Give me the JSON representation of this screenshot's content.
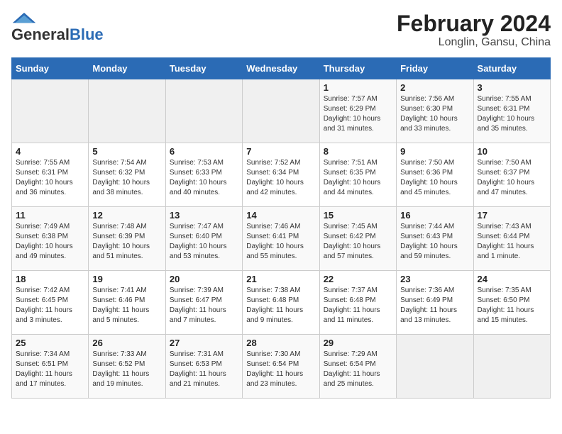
{
  "header": {
    "logo_general": "General",
    "logo_blue": "Blue",
    "title": "February 2024",
    "subtitle": "Longlin, Gansu, China"
  },
  "weekdays": [
    "Sunday",
    "Monday",
    "Tuesday",
    "Wednesday",
    "Thursday",
    "Friday",
    "Saturday"
  ],
  "weeks": [
    [
      {
        "day": "",
        "info": ""
      },
      {
        "day": "",
        "info": ""
      },
      {
        "day": "",
        "info": ""
      },
      {
        "day": "",
        "info": ""
      },
      {
        "day": "1",
        "info": "Sunrise: 7:57 AM\nSunset: 6:29 PM\nDaylight: 10 hours\nand 31 minutes."
      },
      {
        "day": "2",
        "info": "Sunrise: 7:56 AM\nSunset: 6:30 PM\nDaylight: 10 hours\nand 33 minutes."
      },
      {
        "day": "3",
        "info": "Sunrise: 7:55 AM\nSunset: 6:31 PM\nDaylight: 10 hours\nand 35 minutes."
      }
    ],
    [
      {
        "day": "4",
        "info": "Sunrise: 7:55 AM\nSunset: 6:31 PM\nDaylight: 10 hours\nand 36 minutes."
      },
      {
        "day": "5",
        "info": "Sunrise: 7:54 AM\nSunset: 6:32 PM\nDaylight: 10 hours\nand 38 minutes."
      },
      {
        "day": "6",
        "info": "Sunrise: 7:53 AM\nSunset: 6:33 PM\nDaylight: 10 hours\nand 40 minutes."
      },
      {
        "day": "7",
        "info": "Sunrise: 7:52 AM\nSunset: 6:34 PM\nDaylight: 10 hours\nand 42 minutes."
      },
      {
        "day": "8",
        "info": "Sunrise: 7:51 AM\nSunset: 6:35 PM\nDaylight: 10 hours\nand 44 minutes."
      },
      {
        "day": "9",
        "info": "Sunrise: 7:50 AM\nSunset: 6:36 PM\nDaylight: 10 hours\nand 45 minutes."
      },
      {
        "day": "10",
        "info": "Sunrise: 7:50 AM\nSunset: 6:37 PM\nDaylight: 10 hours\nand 47 minutes."
      }
    ],
    [
      {
        "day": "11",
        "info": "Sunrise: 7:49 AM\nSunset: 6:38 PM\nDaylight: 10 hours\nand 49 minutes."
      },
      {
        "day": "12",
        "info": "Sunrise: 7:48 AM\nSunset: 6:39 PM\nDaylight: 10 hours\nand 51 minutes."
      },
      {
        "day": "13",
        "info": "Sunrise: 7:47 AM\nSunset: 6:40 PM\nDaylight: 10 hours\nand 53 minutes."
      },
      {
        "day": "14",
        "info": "Sunrise: 7:46 AM\nSunset: 6:41 PM\nDaylight: 10 hours\nand 55 minutes."
      },
      {
        "day": "15",
        "info": "Sunrise: 7:45 AM\nSunset: 6:42 PM\nDaylight: 10 hours\nand 57 minutes."
      },
      {
        "day": "16",
        "info": "Sunrise: 7:44 AM\nSunset: 6:43 PM\nDaylight: 10 hours\nand 59 minutes."
      },
      {
        "day": "17",
        "info": "Sunrise: 7:43 AM\nSunset: 6:44 PM\nDaylight: 11 hours\nand 1 minute."
      }
    ],
    [
      {
        "day": "18",
        "info": "Sunrise: 7:42 AM\nSunset: 6:45 PM\nDaylight: 11 hours\nand 3 minutes."
      },
      {
        "day": "19",
        "info": "Sunrise: 7:41 AM\nSunset: 6:46 PM\nDaylight: 11 hours\nand 5 minutes."
      },
      {
        "day": "20",
        "info": "Sunrise: 7:39 AM\nSunset: 6:47 PM\nDaylight: 11 hours\nand 7 minutes."
      },
      {
        "day": "21",
        "info": "Sunrise: 7:38 AM\nSunset: 6:48 PM\nDaylight: 11 hours\nand 9 minutes."
      },
      {
        "day": "22",
        "info": "Sunrise: 7:37 AM\nSunset: 6:48 PM\nDaylight: 11 hours\nand 11 minutes."
      },
      {
        "day": "23",
        "info": "Sunrise: 7:36 AM\nSunset: 6:49 PM\nDaylight: 11 hours\nand 13 minutes."
      },
      {
        "day": "24",
        "info": "Sunrise: 7:35 AM\nSunset: 6:50 PM\nDaylight: 11 hours\nand 15 minutes."
      }
    ],
    [
      {
        "day": "25",
        "info": "Sunrise: 7:34 AM\nSunset: 6:51 PM\nDaylight: 11 hours\nand 17 minutes."
      },
      {
        "day": "26",
        "info": "Sunrise: 7:33 AM\nSunset: 6:52 PM\nDaylight: 11 hours\nand 19 minutes."
      },
      {
        "day": "27",
        "info": "Sunrise: 7:31 AM\nSunset: 6:53 PM\nDaylight: 11 hours\nand 21 minutes."
      },
      {
        "day": "28",
        "info": "Sunrise: 7:30 AM\nSunset: 6:54 PM\nDaylight: 11 hours\nand 23 minutes."
      },
      {
        "day": "29",
        "info": "Sunrise: 7:29 AM\nSunset: 6:54 PM\nDaylight: 11 hours\nand 25 minutes."
      },
      {
        "day": "",
        "info": ""
      },
      {
        "day": "",
        "info": ""
      }
    ]
  ]
}
